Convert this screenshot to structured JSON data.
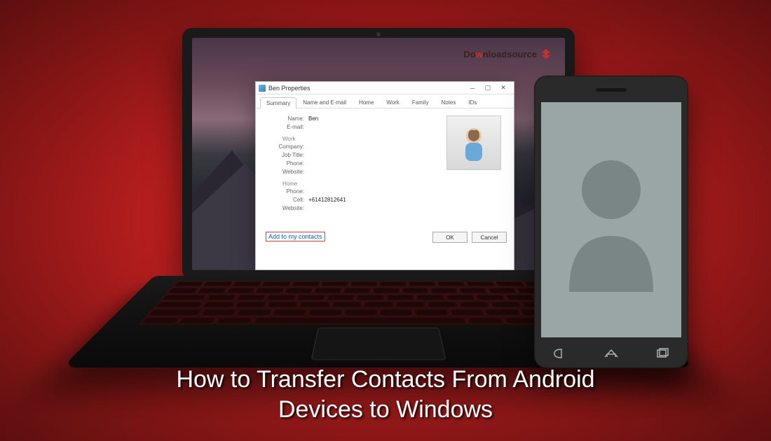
{
  "brand": {
    "text_pre": "Do",
    "text_mid": "w",
    "text_mid2": "nload",
    "text_post": "source"
  },
  "dialog": {
    "title": "Ben Properties",
    "tabs": [
      "Summary",
      "Name and E-mail",
      "Home",
      "Work",
      "Family",
      "Notes",
      "IDs"
    ],
    "active_tab": 0,
    "fields": {
      "name_label": "Name:",
      "name_value": "Ben",
      "email_label": "E-mail:",
      "work_section": "Work",
      "company_label": "Company:",
      "jobtitle_label": "Job Title:",
      "phone_label": "Phone:",
      "website_label": "Website:",
      "home_section": "Home",
      "hphone_label": "Phone:",
      "cell_label": "Cell:",
      "cell_value": "+61412812641",
      "hwebsite_label": "Website:"
    },
    "add_link": "Add to my contacts",
    "ok": "OK",
    "cancel": "Cancel"
  },
  "caption": {
    "line1": "How to Transfer Contacts From Android",
    "line2": "Devices to Windows"
  },
  "colors": {
    "accent_red": "#c83030",
    "link_blue": "#0066cc"
  }
}
